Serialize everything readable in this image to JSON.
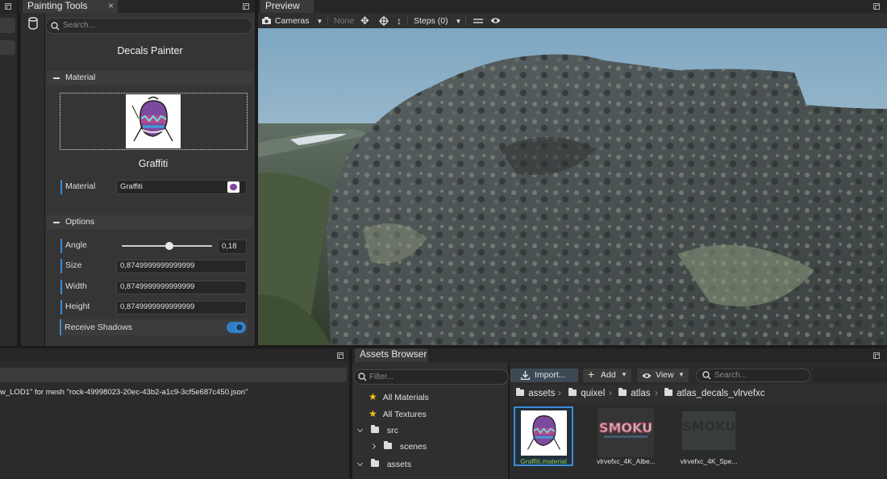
{
  "painting_tools": {
    "tab_label": "Painting Tools",
    "search_placeholder": "Search...",
    "title": "Decals Painter",
    "material_section": "Material",
    "material_name": "Graffiti",
    "material_label": "Material",
    "material_value": "Graffiti",
    "options_section": "Options",
    "angle_label": "Angle",
    "angle_value": "0,18",
    "angle_fraction": 0.53,
    "size_label": "Size",
    "size_value": "0,8749999999999999",
    "width_label": "Width",
    "width_value": "0,8749999999999999",
    "height_label": "Height",
    "height_value": "0,8749999999999999",
    "receive_shadows_label": "Receive Shadows",
    "receive_shadows_on": true
  },
  "preview": {
    "tab_label": "Preview",
    "cameras_label": "Cameras",
    "none_label": "None",
    "steps_label": "Steps (0)"
  },
  "console": {
    "line1": "w_LOD1\" for mesh \"rock-49998023-20ec-43b2-a1c9-3cf5e687c450.json\""
  },
  "assets_browser": {
    "tab_label": "Assets Browser",
    "filter_placeholder": "Filter...",
    "import_label": "Import...",
    "add_label": "Add",
    "view_label": "View",
    "search_placeholder": "Search...",
    "tree": {
      "all_materials": "All Materials",
      "all_textures": "All Textures",
      "src": "src",
      "scenes": "scenes",
      "assets": "assets"
    },
    "breadcrumb": [
      "assets",
      "quixel",
      "atlas",
      "atlas_decals_vlrvefxc"
    ],
    "items": [
      {
        "name": "Graffiti.material",
        "selected": true
      },
      {
        "name": "vlrvefxc_4K_Albe..."
      },
      {
        "name": "vlrvefxc_4K_Spe..."
      }
    ]
  },
  "colors": {
    "accent": "#3a8cd8",
    "selected_name": "#7fd35a",
    "sky": "#8fb1c6"
  }
}
